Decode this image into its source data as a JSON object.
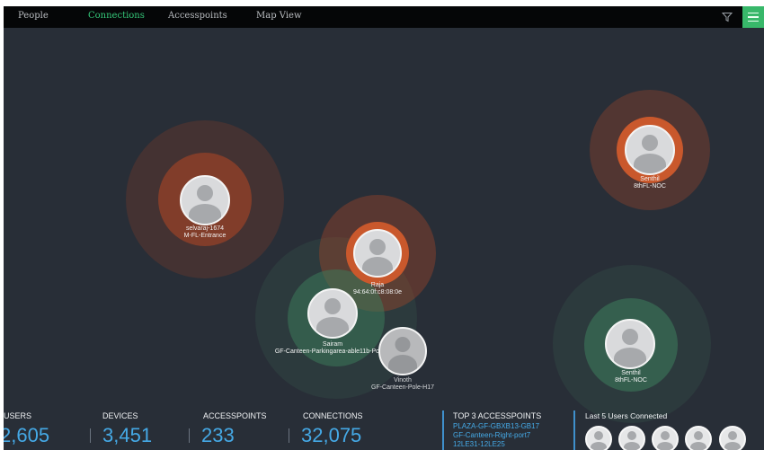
{
  "nav": {
    "tabs": [
      {
        "label": "People",
        "active": false
      },
      {
        "label": "Connections",
        "active": true
      },
      {
        "label": "Accesspoints",
        "active": false
      },
      {
        "label": "Map View",
        "active": false
      }
    ],
    "accent": "#35c97a"
  },
  "nodes": [
    {
      "name": "selvaraj-1674",
      "location": "M-FL-Entrance",
      "status": "orange"
    },
    {
      "name": "Raja",
      "location": "94:64:0f:c8:08:0e",
      "status": "orange"
    },
    {
      "name": "Senthil",
      "location": "8thFL-NOC",
      "status": "orange"
    },
    {
      "name": "Sairam",
      "location": "GF-Canteen-Parkingarea-able11b-Port19",
      "status": "green"
    },
    {
      "name": "Vinoth",
      "location": "GF-Canteen-Pole-H17",
      "status": "gray"
    },
    {
      "name": "Senthil",
      "location": "8thFL-NOC",
      "status": "green"
    }
  ],
  "stats": {
    "users": {
      "label": "USERS",
      "value": "2,605"
    },
    "devices": {
      "label": "DEVICES",
      "value": "3,451"
    },
    "accesspoints": {
      "label": "ACCESSPOINTS",
      "value": "233"
    },
    "connections": {
      "label": "CONNECTIONS",
      "value": "32,075"
    }
  },
  "top_accesspoints": {
    "title": "TOP 3 ACCESSPOINTS",
    "items": [
      "PLAZA-GF-GBXB13-GB17",
      "GF-Canteen-Right-port7",
      "12LE31-12LE25"
    ]
  },
  "last_users": {
    "title": "Last 5 Users Connected",
    "count": 5
  },
  "colors": {
    "background": "#282e37",
    "value_blue": "#45a9e6",
    "orange_ring": "#c0522a",
    "green_ring": "#3f8a66"
  }
}
